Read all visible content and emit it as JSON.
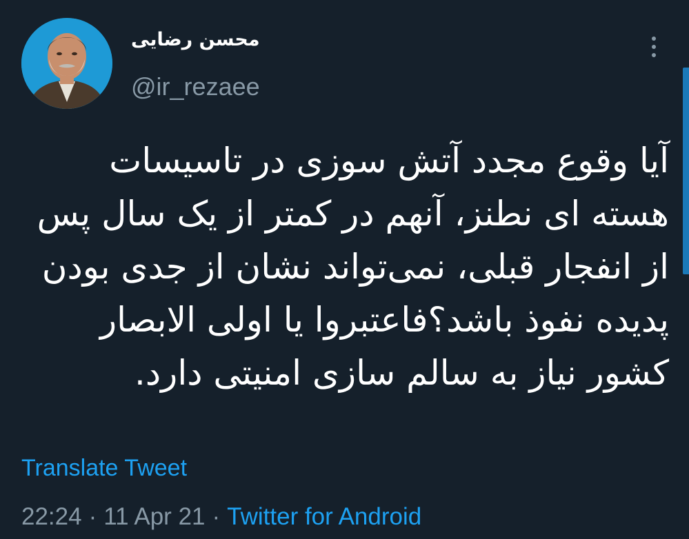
{
  "author": {
    "display_name": "محسن رضایی",
    "handle": "@ir_rezaee",
    "avatar_icon": "profile-photo"
  },
  "menu": {
    "icon": "more-vertical-icon"
  },
  "tweet": {
    "lines": [
      "آیا وقوع مجدد آتش سوزی در تاسیسات",
      "هسته ای نطنز، آنهم در کمتر از یک سال پس",
      "از انفجار قبلی، نمی‌تواند نشان از جدی بودن",
      "پدیده نفوذ باشد؟فاعتبروا یا اولی الابصار",
      "کشور نیاز به سالم سازی امنیتی دارد."
    ],
    "translate_label": "Translate Tweet"
  },
  "meta": {
    "time": "22:24",
    "separator": "·",
    "date": "11 Apr 21",
    "source": "Twitter for Android"
  },
  "colors": {
    "background": "#15202b",
    "link": "#1da1f2",
    "secondary_text": "#8899a6",
    "primary_text": "#ffffff"
  }
}
